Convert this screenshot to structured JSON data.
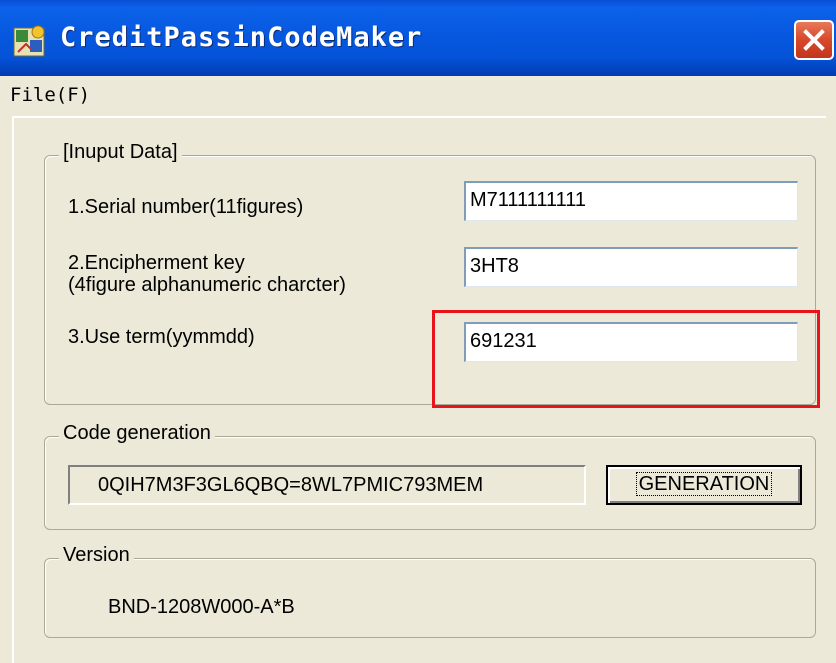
{
  "window": {
    "title": "CreditPassinCodeMaker",
    "app_icon": "app-icon",
    "close_icon": "close-x-icon"
  },
  "menu": {
    "items": [
      {
        "label": "File(F)"
      }
    ]
  },
  "input_group": {
    "label": "[Inuput Data]",
    "fields": [
      {
        "label_line1": "1.Serial number(11figures)",
        "label_line2": "",
        "value": "M7111111111"
      },
      {
        "label_line1": "2.Encipherment key",
        "label_line2": "(4figure alphanumeric charcter)",
        "value": "3HT8"
      },
      {
        "label_line1": "3.Use term(yymmdd)",
        "label_line2": "",
        "value": "691231"
      }
    ]
  },
  "code_group": {
    "label": "Code generation",
    "output": "0QIH7M3F3GL6QBQ=8WL7PMIC793MEM",
    "button_label": "GENERATION"
  },
  "version_group": {
    "label": "Version",
    "value": "BND-1208W000-A*B"
  },
  "annotation": {
    "color": "#e8141c"
  }
}
